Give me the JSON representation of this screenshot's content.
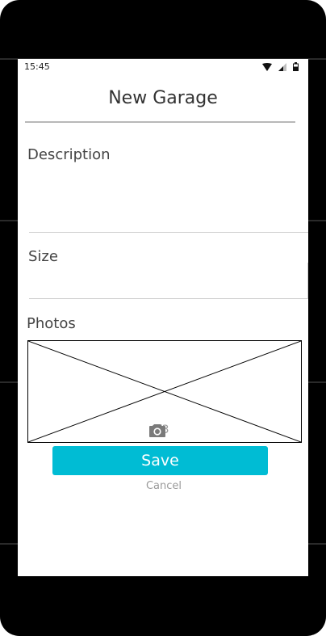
{
  "status_bar": {
    "time": "15:45",
    "icons": [
      "wifi-icon",
      "cell-signal-icon",
      "battery-icon"
    ]
  },
  "header": {
    "title": "New Garage"
  },
  "form": {
    "description": {
      "label": "Description",
      "value": ""
    },
    "size": {
      "label": "Size",
      "value": ""
    },
    "photos": {
      "label": "Photos",
      "count": "0/3",
      "icon": "camera-icon"
    }
  },
  "actions": {
    "save_label": "Save",
    "cancel_label": "Cancel"
  },
  "colors": {
    "accent": "#00bcd4",
    "muted_text": "#9a9a9a",
    "frame": "#000000"
  }
}
